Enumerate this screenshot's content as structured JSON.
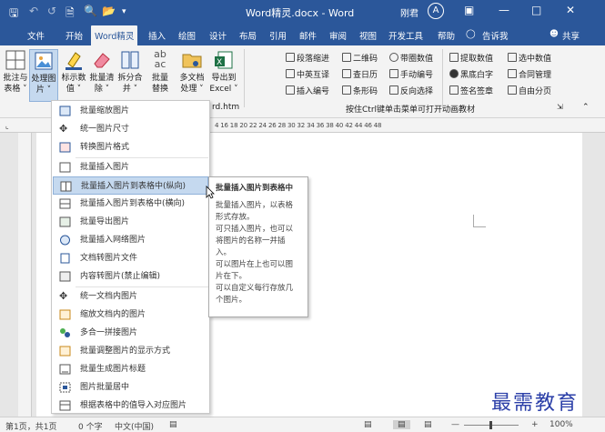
{
  "window": {
    "title": "Word精灵.docx - Word",
    "user_name": "刚君",
    "avatar_letter": "A"
  },
  "tabs": [
    "文件",
    "开始",
    "Word精灵",
    "插入",
    "绘图",
    "设计",
    "布局",
    "引用",
    "邮件",
    "审阅",
    "视图",
    "开发工具",
    "帮助",
    "告诉我",
    "共享"
  ],
  "ribbon": {
    "big_buttons": [
      {
        "label1": "批注与",
        "label2": "表格 ˅"
      },
      {
        "label1": "处理图",
        "label2": "片 ˅"
      },
      {
        "label1": "标示数",
        "label2": "值 ˅"
      },
      {
        "label1": "批量清",
        "label2": "除 ˅"
      },
      {
        "label1": "拆分合",
        "label2": "并 ˅"
      },
      {
        "label1": "批量",
        "label2": "替换"
      },
      {
        "label1": "多文档",
        "label2": "处理 ˅"
      },
      {
        "label1": "导出到",
        "label2": "Excel ˅"
      }
    ],
    "abc_icon_text": "ab\nac",
    "small_buttons": [
      {
        "label": "段落缩进"
      },
      {
        "label": "二维码"
      },
      {
        "label": "带圈数值"
      },
      {
        "label": "中英互译"
      },
      {
        "label": "查日历"
      },
      {
        "label": "手动编号"
      },
      {
        "label": "插入编号"
      },
      {
        "label": "条形码"
      },
      {
        "label": "反向选择"
      },
      {
        "label": "提取数值"
      },
      {
        "label": "选中数值"
      },
      {
        "label": "黑底白字"
      },
      {
        "label": "合同管理"
      },
      {
        "label": "签名签章"
      },
      {
        "label": "自由分页"
      }
    ],
    "group_caption": "按住Ctrl键单击菜单可打开动画教材",
    "partial_caption": "rd.htm"
  },
  "ruler_ticks": "4    16    18    20    22    24    26    28    30    32    34    36    38    40    42    44    46    48",
  "menu": {
    "items": [
      {
        "label": "批量缩放图片",
        "icon": "image-scale-icon"
      },
      {
        "label": "统一图片尺寸",
        "icon": "resize-icon"
      },
      {
        "label": "转换图片格式",
        "icon": "convert-format-icon"
      },
      {
        "label": "批量插入图片",
        "icon": "insert-image-icon"
      },
      {
        "label": "批量插入图片到表格中(纵向)",
        "icon": "table-image-icon"
      },
      {
        "label": "批量插入图片到表格中(横向)",
        "icon": "table-image-icon"
      },
      {
        "label": "批量导出图片",
        "icon": "export-image-icon"
      },
      {
        "label": "批量插入网络图片",
        "icon": "web-image-icon"
      },
      {
        "label": "文档转图片文件",
        "icon": "doc-to-image-icon"
      },
      {
        "label": "内容转图片(禁止编辑)",
        "icon": "lock-image-icon"
      },
      {
        "label": "统一文档内图片",
        "icon": "resize-icon"
      },
      {
        "label": "缩放文档内的图片",
        "icon": "zoom-image-icon"
      },
      {
        "label": "多合一拼接图片",
        "icon": "merge-images-icon"
      },
      {
        "label": "批量调整图片的显示方式",
        "icon": "layout-image-icon"
      },
      {
        "label": "批量生成图片标题",
        "icon": "caption-icon"
      },
      {
        "label": "图片批量居中",
        "icon": "center-image-icon"
      },
      {
        "label": "根据表格中的值导入对应图片",
        "icon": "import-by-value-icon"
      }
    ]
  },
  "tooltip": {
    "title": "批量插入图片到表格中",
    "lines": [
      "批量插入图片，以表格",
      "形式存放。",
      "可只插入图片，也可以",
      "将图片的名称一并插",
      "入。",
      "可以图片在上也可以图",
      "片在下。",
      "可以自定义每行存放几",
      "个图片。"
    ]
  },
  "status": {
    "page": "第1页，共1页",
    "words": "0 个字",
    "lang": "中文(中国)",
    "zoom": "100%"
  },
  "watermark": "最需教育",
  "colors": {
    "brand": "#2b579a",
    "highlight": "#c5d9ef",
    "watermark": "#2b3fa8"
  }
}
